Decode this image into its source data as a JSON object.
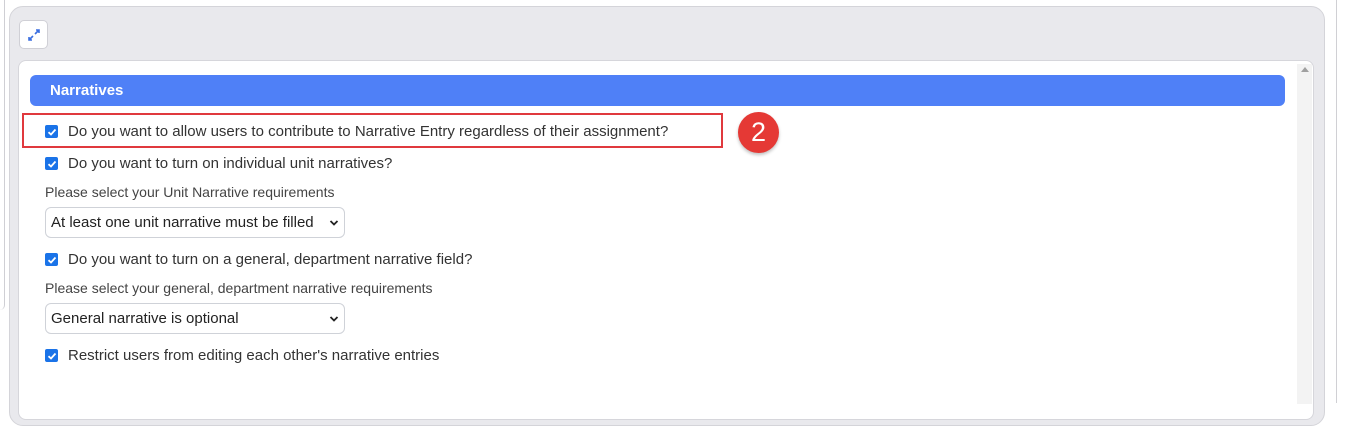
{
  "section": {
    "title": "Narratives"
  },
  "options": {
    "allow_contribute": {
      "label": "Do you want to allow users to contribute to Narrative Entry regardless of their assignment?",
      "checked": true
    },
    "unit_narratives": {
      "label": "Do you want to turn on individual unit narratives?",
      "checked": true
    },
    "unit_requirements": {
      "label": "Please select your Unit Narrative requirements",
      "value": "At least one unit narrative must be filled"
    },
    "general_narrative": {
      "label": "Do you want to turn on a general, department narrative field?",
      "checked": true
    },
    "general_requirements": {
      "label": "Please select your general, department narrative requirements",
      "value": "General narrative is optional"
    },
    "restrict_editing": {
      "label": "Restrict users from editing each other's narrative entries",
      "checked": true
    }
  },
  "annotation": {
    "step_number": "2",
    "color": "#e53935"
  },
  "colors": {
    "header": "#4f80f7",
    "checkbox": "#1a73e8",
    "highlight": "#e0393e"
  },
  "icons": {
    "expand": "expand-arrows-icon",
    "checkbox": "checkmark-icon",
    "select": "chevron-down-icon",
    "scroll": "scroll-up-arrow-icon"
  }
}
